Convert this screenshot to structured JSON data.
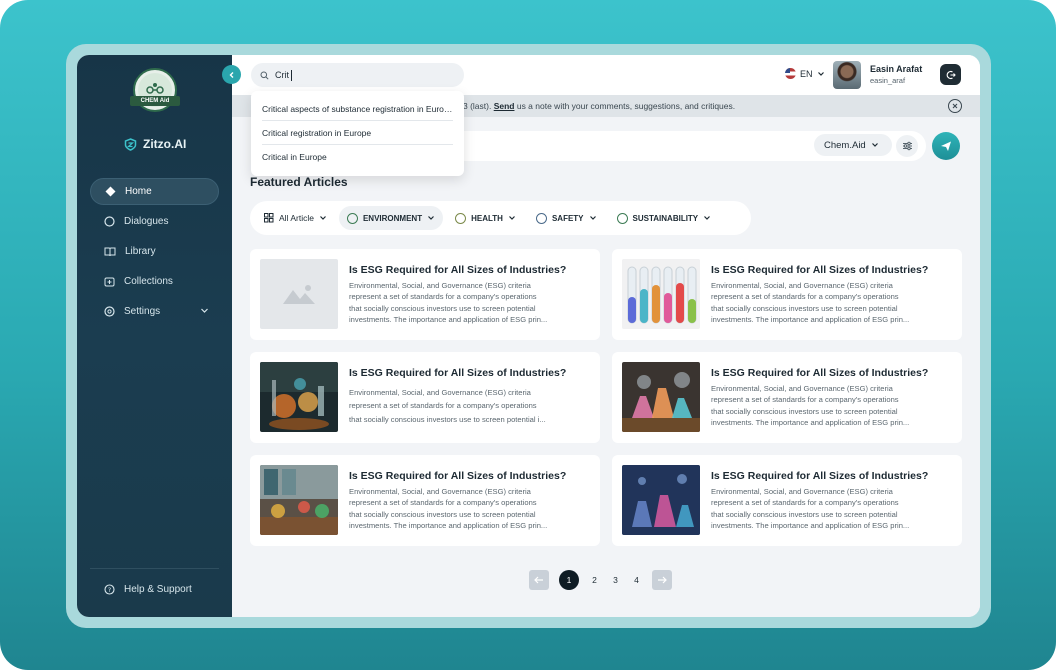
{
  "sidebar": {
    "logo_text": "CHEM Aid",
    "brand": "Zitzo.AI",
    "items": [
      {
        "label": "Home",
        "icon": "diamond-icon"
      },
      {
        "label": "Dialogues",
        "icon": "chat-icon"
      },
      {
        "label": "Library",
        "icon": "book-icon"
      },
      {
        "label": "Collections",
        "icon": "collection-icon"
      },
      {
        "label": "Settings",
        "icon": "gear-icon"
      }
    ],
    "help": "Help  & Support"
  },
  "search": {
    "value": "Crit",
    "suggestions": [
      "Critical aspects of substance registration in Europe",
      "Critical registration in Europe",
      "Critical in Europe"
    ]
  },
  "topbar": {
    "language": "EN",
    "user_name": "Easin Arafat",
    "user_handle": "easin_araf"
  },
  "notice": {
    "prefix": "3 (last). ",
    "link": "Send",
    "suffix": " us a note with your comments, suggestions, and critiques."
  },
  "chat": {
    "model": "Chem.Aid"
  },
  "featured": {
    "title": "Featured Articles",
    "categories": [
      "All Article",
      "ENVIRONMENT",
      "HEALTH",
      "SAFETY",
      "SUSTAINABILITY"
    ]
  },
  "articles": [
    {
      "title": "Is ESG Required for All Sizes of Industries?",
      "lines": [
        "Environmental, Social, and Governance (ESG) criteria",
        "represent a set of standards for a company's operations",
        "that socially conscious investors use to screen potential",
        "investments. The importance and application of ESG prin..."
      ]
    },
    {
      "title": "Is ESG Required for All Sizes of Industries?",
      "lines": [
        "Environmental, Social, and Governance (ESG) criteria",
        "represent a set of standards for a company's operations",
        "that socially conscious investors use to screen potential",
        "investments. The importance and application of ESG prin..."
      ]
    },
    {
      "title": "Is ESG Required for All Sizes of Industries?",
      "lines": [
        "Environmental, Social, and Governance (ESG) criteria",
        "represent a set of standards for a company's operations",
        "that socially conscious investors use to screen potential i..."
      ]
    },
    {
      "title": "Is ESG Required for All Sizes of Industries?",
      "lines": [
        "Environmental, Social, and Governance (ESG) criteria",
        "represent a set of standards for a company's operations",
        "that socially conscious investors use to screen potential",
        "investments. The importance and application of ESG prin..."
      ]
    },
    {
      "title": "Is ESG Required for All Sizes of Industries?",
      "lines": [
        "Environmental, Social, and Governance (ESG) criteria",
        "represent a set of standards for a company's operations",
        "that socially conscious investors use to screen potential",
        "investments. The importance and application of ESG prin..."
      ]
    },
    {
      "title": "Is ESG Required for All Sizes of Industries?",
      "lines": [
        "Environmental, Social, and Governance (ESG) criteria",
        "represent a set of standards for a company's operations",
        "that socially conscious investors use to screen potential",
        "investments. The importance and application of ESG prin..."
      ]
    }
  ],
  "pagination": {
    "pages": [
      "1",
      "2",
      "3",
      "4"
    ],
    "current": "1"
  },
  "colors": {
    "accent": "#2aa6ad",
    "sidebar": "#173547",
    "background": "#f2f4f7"
  }
}
